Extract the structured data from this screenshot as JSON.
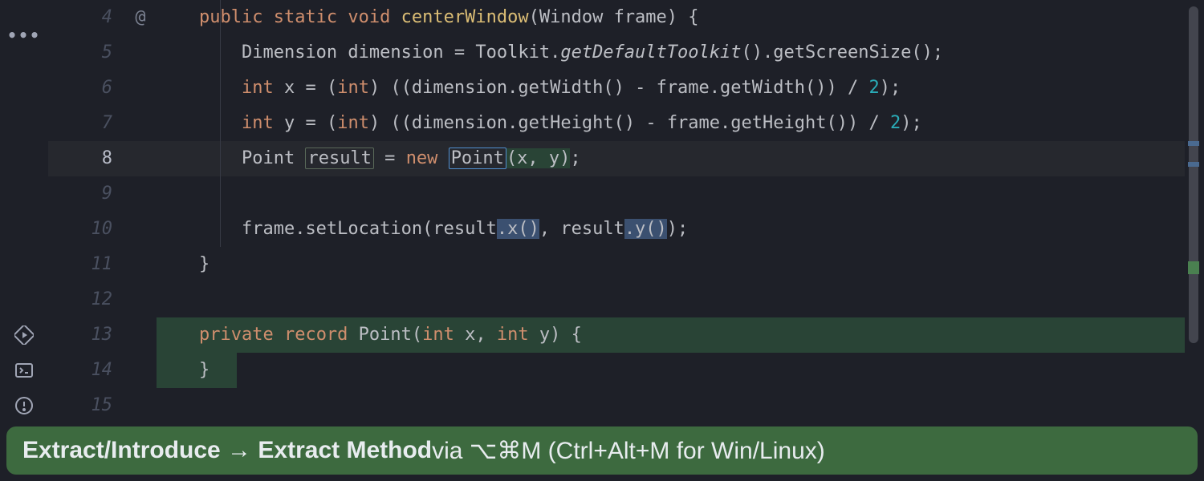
{
  "gutter": {
    "dots": "•••"
  },
  "lines": {
    "start": 4,
    "end": 15,
    "current": 8,
    "annotation4": "@"
  },
  "code": {
    "l4": {
      "indent": "    ",
      "t1": "public static void ",
      "fn": "centerWindow",
      "t2": "(Window frame) {"
    },
    "l5": {
      "indent": "        ",
      "t1": "Dimension dimension = Toolkit.",
      "it": "getDefaultToolkit",
      "t2": "().getScreenSize();"
    },
    "l6": {
      "indent": "        ",
      "kw1": "int",
      "t1": " x = (",
      "kw2": "int",
      "t2": ") ((dimension.getWidth() - frame.getWidth()) / ",
      "num": "2",
      "t3": ");"
    },
    "l7": {
      "indent": "        ",
      "kw1": "int",
      "t1": " y = (",
      "kw2": "int",
      "t2": ") ((dimension.getHeight() - frame.getHeight()) / ",
      "num": "2",
      "t3": ");"
    },
    "l8": {
      "indent": "        ",
      "cls": "Point ",
      "box1": "result",
      "t1": " = ",
      "kw": "new",
      "t2": " ",
      "box2": "Point",
      "t3": "(x, y)",
      "t4": ";"
    },
    "l9": {
      "indent": ""
    },
    "l10": {
      "indent": "        ",
      "t1": "frame.setLocation(result",
      "sel1": ".x()",
      "t2": ", result",
      "sel2": ".y()",
      "t3": ");"
    },
    "l11": {
      "indent": "    ",
      "t1": "}"
    },
    "l12": {
      "indent": ""
    },
    "l13": {
      "indent": "    ",
      "kw1": "private",
      "t1": " ",
      "kw2": "record",
      "t2": " Point(",
      "kw3": "int",
      "t3": " x, ",
      "kw4": "int",
      "t4": " y) {"
    },
    "l14": {
      "indent": "    ",
      "t1": "}"
    },
    "l15": {
      "indent": ""
    }
  },
  "hint": {
    "bold1": "Extract/Introduce → Extract Method",
    "normal": " via ⌥⌘M (Ctrl+Alt+M for Win/Linux)"
  }
}
